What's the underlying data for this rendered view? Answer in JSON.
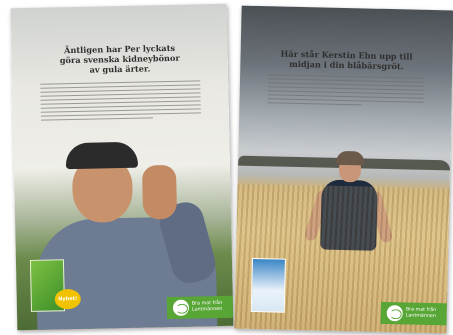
{
  "left_ad": {
    "headline_lines": [
      "Äntligen har Per lyckats",
      "göra svenska kidneybönor",
      "av gula ärter."
    ],
    "product_badge": "Nyhet!",
    "brand_tag": [
      "Bra mat från",
      "Lantmännen"
    ]
  },
  "right_ad": {
    "headline_lines": [
      "Här står Kerstin Ebn upp till",
      "midjan i din blåbärsgröt."
    ],
    "brand_tag": [
      "Bra mat från",
      "Lantmännen"
    ]
  },
  "icons": [
    "lantmannen-logo-icon",
    "bean-package-icon",
    "porridge-package-icon"
  ]
}
